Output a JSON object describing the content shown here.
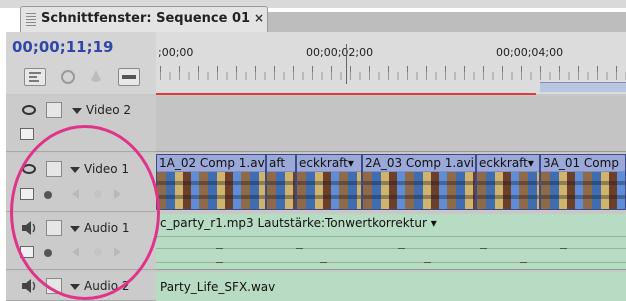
{
  "window": {
    "tab_title": "Schnittfenster: Sequence 01",
    "close_glyph": "×"
  },
  "header": {
    "timecode": "00;00;11;19",
    "icons": [
      "snap-icon",
      "marker-icon",
      "keyframe-icon",
      "sequence-icon"
    ]
  },
  "ruler": {
    "labels": [
      ";00;00",
      "00;00;02;00",
      "00;00;04;00"
    ]
  },
  "tracks": [
    {
      "name": "Video 2",
      "kind": "video"
    },
    {
      "name": "Video 1",
      "kind": "video"
    },
    {
      "name": "Audio 1",
      "kind": "audio"
    },
    {
      "name": "Audio 2",
      "kind": "audio"
    }
  ],
  "clips": {
    "video1": [
      {
        "label": "1A_02 Comp 1.avi"
      },
      {
        "label": "aft"
      },
      {
        "label": "eckkraft▾"
      },
      {
        "label": "2A_03 Comp 1.avi"
      },
      {
        "label": "eckkraft▾"
      },
      {
        "label": "3A_01 Comp"
      }
    ],
    "audio1_label": "c_party_r1.mp3 Lautstärke:Tonwertkorrektur ▾",
    "audio2_label": "Party_Life_SFX.wav"
  },
  "colors": {
    "timecode": "#3147a8",
    "video_clip": "#7f8fc7",
    "audio_clip": "#b8dcc3",
    "highlight": "#e0338a",
    "work_area_line": "#e03a3a"
  }
}
